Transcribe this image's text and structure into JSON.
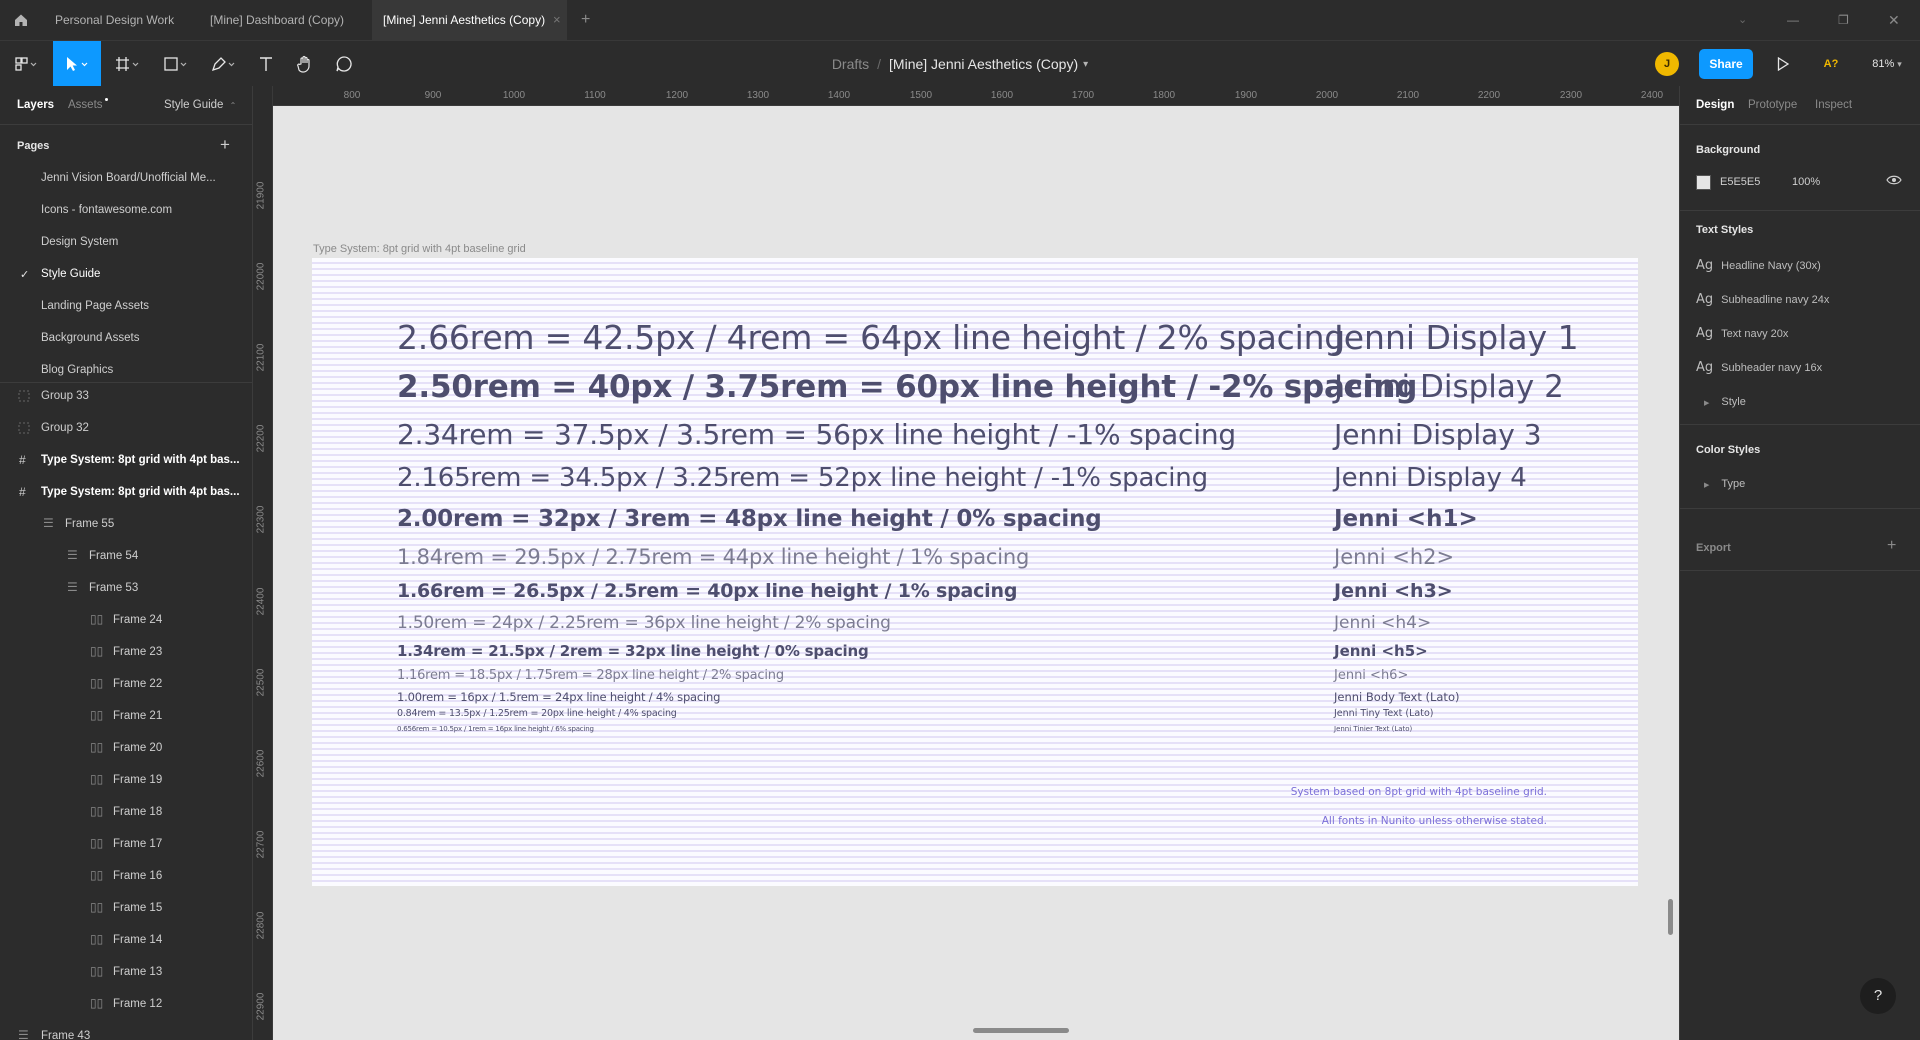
{
  "tabs": [
    "Personal Design Work",
    "[Mine] Dashboard (Copy)",
    "[Mine] Jenni Aesthetics (Copy)"
  ],
  "header": {
    "breadcrumb_parent": "Drafts",
    "separator": "/",
    "file_title": "[Mine] Jenni Aesthetics (Copy)",
    "avatar_initial": "J",
    "share_label": "Share",
    "a11y_label": "A?",
    "zoom": "81%"
  },
  "left_panel": {
    "tabs": [
      "Layers",
      "Assets"
    ],
    "dropdown": "Style Guide",
    "pages_title": "Pages",
    "pages": [
      "Jenni Vision Board/Unofficial Me...",
      "Icons - fontawesome.com",
      "Design System",
      "Style Guide",
      "Landing Page Assets",
      "Background Assets",
      "Blog Graphics"
    ],
    "selected_page_check": "✓",
    "layers": [
      "Group 33",
      "Group 32",
      "Type System: 8pt grid with 4pt bas...",
      "Type System: 8pt grid with 4pt bas...",
      "Frame 55",
      "Frame 54",
      "Frame 53",
      "Frame 24",
      "Frame 23",
      "Frame 22",
      "Frame 21",
      "Frame 20",
      "Frame 19",
      "Frame 18",
      "Frame 17",
      "Frame 16",
      "Frame 15",
      "Frame 14",
      "Frame 13",
      "Frame 12",
      "Frame 43"
    ]
  },
  "right_panel": {
    "tabs": [
      "Design",
      "Prototype",
      "Inspect"
    ],
    "background_title": "Background",
    "bg_hex": "E5E5E5",
    "bg_opacity": "100%",
    "text_styles_title": "Text Styles",
    "text_styles": [
      "Headline Navy (30x)",
      "Subheadline navy 24x",
      "Text navy 20x",
      "Subheader navy 16x"
    ],
    "ag": "Ag",
    "style_group": "Style",
    "color_styles_title": "Color Styles",
    "color_group": "Type",
    "export_title": "Export"
  },
  "ruler": {
    "x": [
      "800",
      "900",
      "1000",
      "1100",
      "1200",
      "1300",
      "1400",
      "1500",
      "1600",
      "1700",
      "1800",
      "1900",
      "2000",
      "2100",
      "2200",
      "2300",
      "2400"
    ],
    "y": [
      "21900",
      "22000",
      "22100",
      "22200",
      "22300",
      "22400",
      "22500",
      "22600",
      "22700",
      "22800",
      "22900"
    ]
  },
  "canvas": {
    "frame_label": "Type System: 8pt grid with 4pt baseline grid",
    "type_specs": [
      {
        "spec": "2.66rem = 42.5px  /  4rem = 64px line height  /  2% spacing",
        "name": "Jenni Display 1"
      },
      {
        "spec": "2.50rem = 40px  /  3.75rem = 60px line height  /  -2% spacing",
        "name": "Jenni Display 2"
      },
      {
        "spec": "2.34rem = 37.5px  /  3.5rem = 56px line height  /  -1% spacing",
        "name": "Jenni Display 3"
      },
      {
        "spec": "2.165rem = 34.5px  /  3.25rem = 52px line height  /  -1% spacing",
        "name": "Jenni Display 4"
      },
      {
        "spec": "2.00rem = 32px  /  3rem = 48px line height  /  0% spacing",
        "name": "Jenni <h1>"
      },
      {
        "spec": "1.84rem = 29.5px  /  2.75rem = 44px line height  / 1% spacing",
        "name": "Jenni <h2>"
      },
      {
        "spec": "1.66rem = 26.5px  /  2.5rem = 40px line height  /  1% spacing",
        "name": "Jenni <h3>"
      },
      {
        "spec": "1.50rem = 24px  /  2.25rem = 36px line height  /  2% spacing",
        "name": "Jenni <h4>"
      },
      {
        "spec": "1.34rem = 21.5px  /  2rem = 32px line height  /  0% spacing",
        "name": "Jenni <h5>"
      },
      {
        "spec": "1.16rem = 18.5px  /  1.75rem = 28px line height  /  2% spacing",
        "name": "Jenni <h6>"
      },
      {
        "spec": "1.00rem = 16px  /  1.5rem = 24px line height  / 4% spacing",
        "name": "Jenni Body Text (Lato)"
      },
      {
        "spec": "0.84rem = 13.5px  /  1.25rem = 20px line height  /  4% spacing",
        "name": "Jenni Tiny Text (Lato)"
      },
      {
        "spec": "0.656rem = 10.5px  /  1rem = 16px line height  /  6% spacing",
        "name": "Jenni Tinier Text (Lato)"
      }
    ],
    "note_1": "System based on 8pt grid with 4pt baseline grid.",
    "note_2": "All fonts in Nunito unless otherwise stated."
  },
  "help_label": "?",
  "colors": {
    "accent": "#0d99ff",
    "text_navy": "#4e4e6e",
    "note_purple": "#7b6fd8",
    "avatar": "#f0b800"
  }
}
